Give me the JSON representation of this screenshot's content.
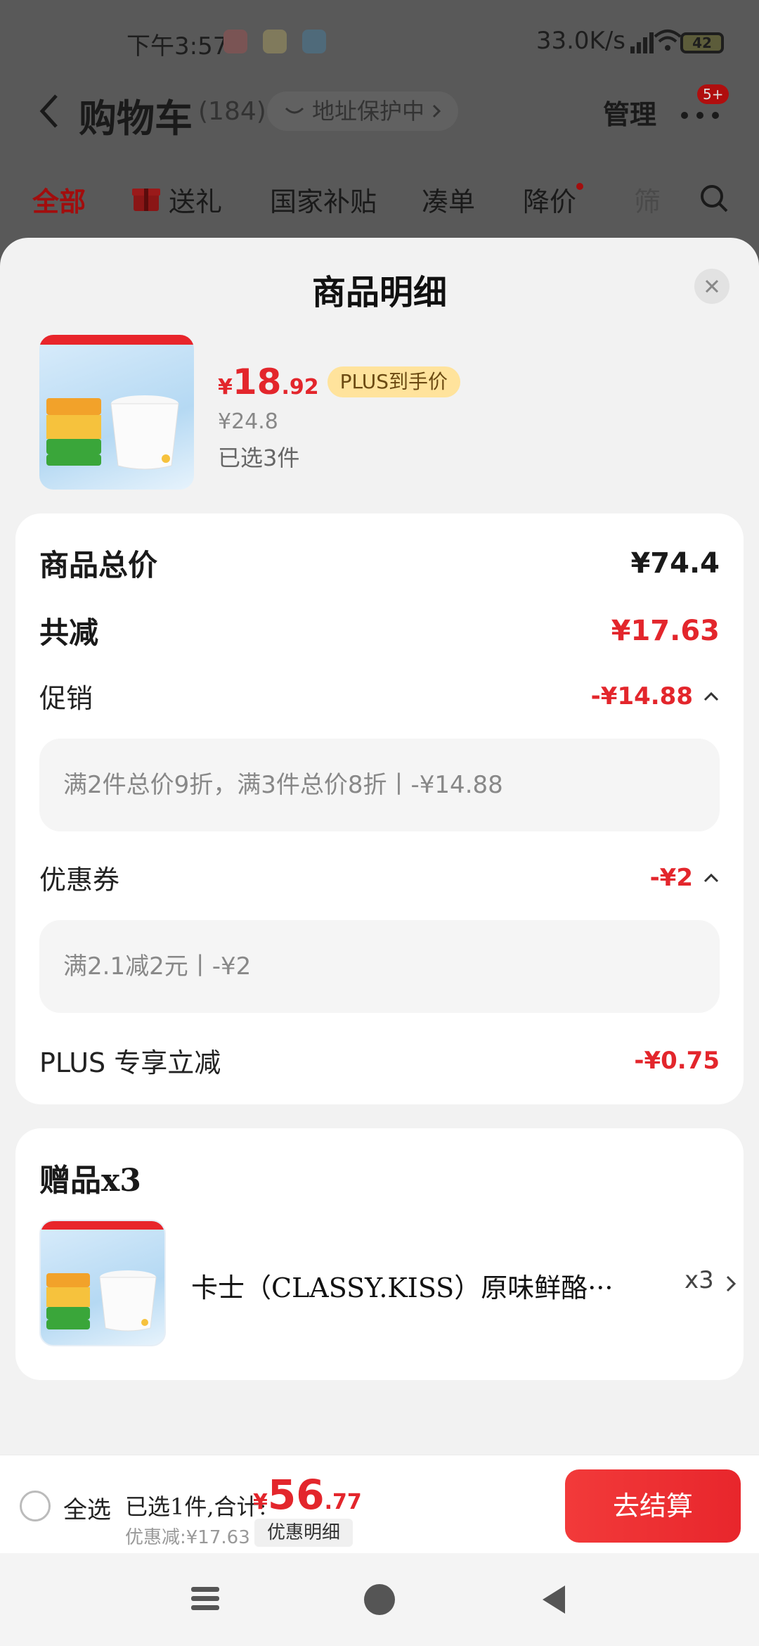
{
  "status_bar": {
    "time": "下午3:57",
    "net_speed": "33.0K/s",
    "battery": "42"
  },
  "cart": {
    "title": "购物车",
    "count": "(184)",
    "address": "地址保护中",
    "manage": "管理",
    "badge": "5+"
  },
  "filters": [
    "全部",
    "送礼",
    "国家补贴",
    "凑单",
    "降价",
    "筛"
  ],
  "sheet": {
    "title": "商品明细",
    "product": {
      "price_symbol": "¥",
      "price_int": "18",
      "price_dec": ".92",
      "plus_tag": "PLUS到手价",
      "original_price": "¥24.8",
      "selected": "已选3件"
    },
    "breakdown": {
      "total_label": "商品总价",
      "total_value": "¥74.4",
      "reduce_label": "共减",
      "reduce_value": "¥17.63",
      "promo_label": "促销",
      "promo_value": "-¥14.88",
      "promo_detail": "满2件总价9折，满3件总价8折丨-¥14.88",
      "coupon_label": "优惠券",
      "coupon_value": "-¥2",
      "coupon_detail": "满2.1减2元丨-¥2",
      "plus_label": "PLUS 专享立减",
      "plus_value": "-¥0.75"
    },
    "gift": {
      "title": "赠品x3",
      "name": "卡士（CLASSY.KISS）原味鲜酪···",
      "qty": "x3"
    }
  },
  "bottom_bar": {
    "select_all": "全选",
    "summary": "已选1件,合计:",
    "price_symbol": "¥",
    "price_int": "56",
    "price_dec": ".77",
    "discount": "优惠减:¥17.63",
    "discount_detail": "优惠明细",
    "checkout": "去结算"
  },
  "colors": {
    "accent_red": "#e3262c",
    "plus_gold": "#ffe39c"
  }
}
